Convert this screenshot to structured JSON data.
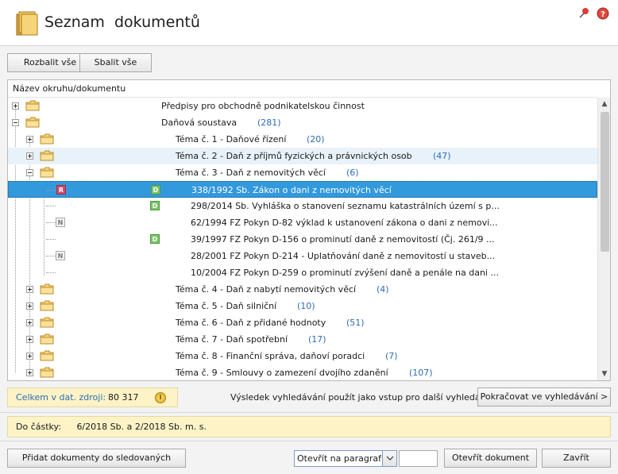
{
  "header": {
    "title": "Seznam  dokumentů"
  },
  "toolbar": {
    "expand_all": "Rozbalit vše",
    "collapse_all": "Sbalit vše"
  },
  "tree": {
    "column_header": "Název okruhu/dokumentu",
    "rows": [
      {
        "type": "folder",
        "expander": "plus",
        "label": "Předpisy pro obchodně podnikatelskou činnost",
        "count": ""
      },
      {
        "type": "folder",
        "expander": "minus",
        "label": "Daňová soustava",
        "count": "(281)"
      },
      {
        "type": "folder",
        "expander": "plus",
        "label": "Téma č. 1 - Daňové řízení",
        "count": "(20)"
      },
      {
        "type": "folder",
        "expander": "plus",
        "label": "Téma č. 2 - Daň z příjmů fyzických a právnických osob",
        "count": "(47)"
      },
      {
        "type": "folder",
        "expander": "minus",
        "label": "Téma č. 3 - Daň z nemovitých věcí",
        "count": "(6)"
      },
      {
        "type": "doc",
        "badge1": "R",
        "badge2": "D",
        "label": "338/1992 Sb. Zákon o dani z nemovitých věcí"
      },
      {
        "type": "doc",
        "badge1": "",
        "badge2": "D",
        "label": "298/2014 Sb. Vyhláška o stanovení seznamu katastrálních území s p..."
      },
      {
        "type": "doc",
        "badge1": "N",
        "badge2": "",
        "label": "62/1994 FZ Pokyn D-82 výklad k ustanovení zákona o dani z nemovi..."
      },
      {
        "type": "doc",
        "badge1": "",
        "badge2": "D",
        "label": "39/1997 FZ Pokyn D-156 o prominutí daně z nemovitostí (Čj. 261/9 ..."
      },
      {
        "type": "doc",
        "badge1": "N",
        "badge2": "",
        "label": "28/2001 FZ Pokyn D-214 - Uplatňování daně z nemovitostí u staveb..."
      },
      {
        "type": "doc",
        "badge1": "",
        "badge2": "",
        "label": "10/2004 FZ Pokyn D-259 o prominutí zvýšení daně a penále na dani ..."
      },
      {
        "type": "folder",
        "expander": "plus",
        "label": "Téma č. 4 - Daň z nabytí nemovitých věcí",
        "count": "(4)"
      },
      {
        "type": "folder",
        "expander": "plus",
        "label": "Téma č. 5 - Daň silniční",
        "count": "(10)"
      },
      {
        "type": "folder",
        "expander": "plus",
        "label": "Téma č. 6 - Daň z přidané hodnoty",
        "count": "(51)"
      },
      {
        "type": "folder",
        "expander": "plus",
        "label": "Téma č. 7 - Daň spotřební",
        "count": "(17)"
      },
      {
        "type": "folder",
        "expander": "plus",
        "label": "Téma č. 8 - Finanční správa, daňoví poradci",
        "count": "(7)"
      },
      {
        "type": "folder",
        "expander": "plus",
        "label": "Téma č. 9 - Smlouvy o zamezení dvojího zdanění",
        "count": "(107)"
      }
    ],
    "selected_row": 5,
    "hover_row": 3
  },
  "status": {
    "total_label": "Celkem v dat. zdroji:",
    "total_value": "80 317",
    "search_hint": "Výsledek vyhledávání použít jako vstup pro další vyhledávání:",
    "continue_button": "Pokračovat ve vyhledávání >",
    "issue_label": "Do částky:",
    "issue_value": "6/2018 Sb. a 2/2018 Sb. m. s."
  },
  "actions": {
    "add_watch": "Přidat dokumenty do sledovaných",
    "open_paragraph": "Otevřít na paragrafu:",
    "paragraph_value": "",
    "open_document": "Otevřít dokument",
    "close": "Zavřít"
  },
  "colors": {
    "selected": "#3399dd",
    "count": "#2c6cb4",
    "info_bg": "#fdf3c6",
    "hover": "#e8f2fa"
  }
}
